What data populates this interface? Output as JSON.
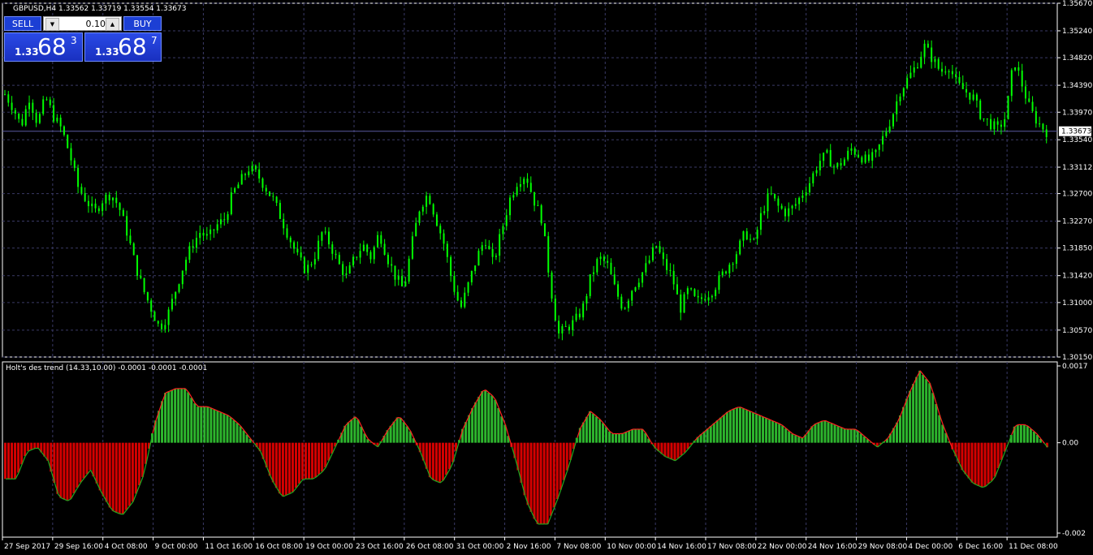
{
  "symbol_header": "GBPUSD,H4  1.33562 1.33719 1.33554 1.33673",
  "trade_panel": {
    "sell_label": "SELL",
    "buy_label": "BUY",
    "lot": "0.10",
    "sell_quote": {
      "prefix": "1.33",
      "big": "68",
      "sup": "3"
    },
    "buy_quote": {
      "prefix": "1.33",
      "big": "68",
      "sup": "7"
    }
  },
  "current_price_label": "1.33673",
  "indicator_header": "Holt's des trend (14.33,10.00) -0.0001 -0.0001 -0.0001",
  "colors": {
    "background": "#000000",
    "grid": "#3a3a66",
    "bull_candle": "#00ff00",
    "histogram_up": "#2db52d",
    "histogram_down": "#d40000",
    "histogram_line_up": "#ff2020",
    "histogram_line_down": "#22aa22",
    "panel_button": "#1c3fd4"
  },
  "chart_data": [
    {
      "type": "candlestick",
      "price_axis_ticks": [
        "1.35670",
        "1.35240",
        "1.34820",
        "1.34390",
        "1.33970",
        "1.33540",
        "1.33112",
        "1.32700",
        "1.32270",
        "1.31850",
        "1.31420",
        "1.31000",
        "1.30570",
        "1.30150"
      ],
      "ylim": [
        1.3015,
        1.3567
      ],
      "time_labels": [
        "27 Sep 2017",
        "29 Sep 16:00",
        "4 Oct 08:00",
        "9 Oct 00:00",
        "11 Oct 16:00",
        "16 Oct 08:00",
        "19 Oct 00:00",
        "23 Oct 16:00",
        "26 Oct 08:00",
        "31 Oct 00:00",
        "2 Nov 16:00",
        "7 Nov 08:00",
        "10 Nov 00:00",
        "14 Nov 16:00",
        "17 Nov 08:00",
        "22 Nov 00:00",
        "24 Nov 16:00",
        "29 Nov 08:00",
        "4 Dec 00:00",
        "6 Dec 16:00",
        "11 Dec 08:00"
      ],
      "close_path": [
        1.3425,
        1.3405,
        1.3375,
        1.342,
        1.338,
        1.342,
        1.339,
        1.337,
        1.333,
        1.328,
        1.326,
        1.324,
        1.326,
        1.327,
        1.325,
        1.321,
        1.316,
        1.312,
        1.309,
        1.306,
        1.308,
        1.312,
        1.316,
        1.319,
        1.321,
        1.32,
        1.322,
        1.323,
        1.327,
        1.329,
        1.331,
        1.33,
        1.328,
        1.326,
        1.323,
        1.32,
        1.317,
        1.315,
        1.317,
        1.321,
        1.319,
        1.316,
        1.314,
        1.317,
        1.319,
        1.317,
        1.321,
        1.317,
        1.314,
        1.312,
        1.319,
        1.325,
        1.327,
        1.323,
        1.319,
        1.313,
        1.309,
        1.313,
        1.317,
        1.32,
        1.316,
        1.321,
        1.326,
        1.329,
        1.33,
        1.326,
        1.323,
        1.313,
        1.305,
        1.306,
        1.307,
        1.309,
        1.314,
        1.317,
        1.316,
        1.312,
        1.309,
        1.312,
        1.314,
        1.316,
        1.319,
        1.316,
        1.314,
        1.309,
        1.312,
        1.31,
        1.311,
        1.312,
        1.314,
        1.316,
        1.318,
        1.321,
        1.319,
        1.324,
        1.327,
        1.325,
        1.324,
        1.325,
        1.327,
        1.329,
        1.332,
        1.333,
        1.331,
        1.332,
        1.334,
        1.333,
        1.332,
        1.333,
        1.336,
        1.339,
        1.343,
        1.345,
        1.347,
        1.35,
        1.348,
        1.346,
        1.347,
        1.344,
        1.343,
        1.342,
        1.339,
        1.338,
        1.337,
        1.339,
        1.348,
        1.344,
        1.34,
        1.338,
        1.3367
      ],
      "last_price": 1.33673
    },
    {
      "type": "histogram",
      "series": [
        {
          "name": "Holt's des trend (14.33,10.00)"
        }
      ],
      "axis_ticks": [
        "0.0017",
        "0.00",
        "-0.002"
      ],
      "ylim": [
        -0.002,
        0.0017
      ],
      "values": [
        -0.0008,
        -0.0008,
        -0.0002,
        -0.0001,
        -0.0004,
        -0.0012,
        -0.0013,
        -0.0009,
        -0.0006,
        -0.0011,
        -0.0015,
        -0.0016,
        -0.0013,
        -0.0007,
        0.0004,
        0.0011,
        0.0012,
        0.0012,
        0.0008,
        0.0008,
        0.0007,
        0.0006,
        0.0004,
        0.0001,
        -0.0002,
        -0.0008,
        -0.0012,
        -0.0011,
        -0.0008,
        -0.0008,
        -0.0006,
        -0.0001,
        0.0004,
        0.0006,
        0.0001,
        -0.0001,
        0.0003,
        0.0006,
        0.0003,
        -0.0002,
        -0.0008,
        -0.0009,
        -0.0005,
        0.0003,
        0.0008,
        0.0012,
        0.001,
        0.0004,
        -0.0004,
        -0.0013,
        -0.0018,
        -0.0018,
        -0.0012,
        -0.0005,
        0.0003,
        0.0007,
        0.0005,
        0.0002,
        0.0002,
        0.0003,
        0.0003,
        -0.0001,
        -0.0003,
        -0.0004,
        -0.0002,
        0.0001,
        0.0003,
        0.0005,
        0.0007,
        0.0008,
        0.0007,
        0.0006,
        0.0005,
        0.0004,
        0.0002,
        0.0001,
        0.0004,
        0.0005,
        0.0004,
        0.0003,
        0.0003,
        0.0001,
        -0.0001,
        0.0001,
        0.0005,
        0.0011,
        0.0016,
        0.0013,
        0.0005,
        -0.0001,
        -0.0006,
        -0.0009,
        -0.001,
        -0.0008,
        -0.0002,
        0.0004,
        0.0004,
        0.0002,
        -0.0001
      ]
    }
  ]
}
